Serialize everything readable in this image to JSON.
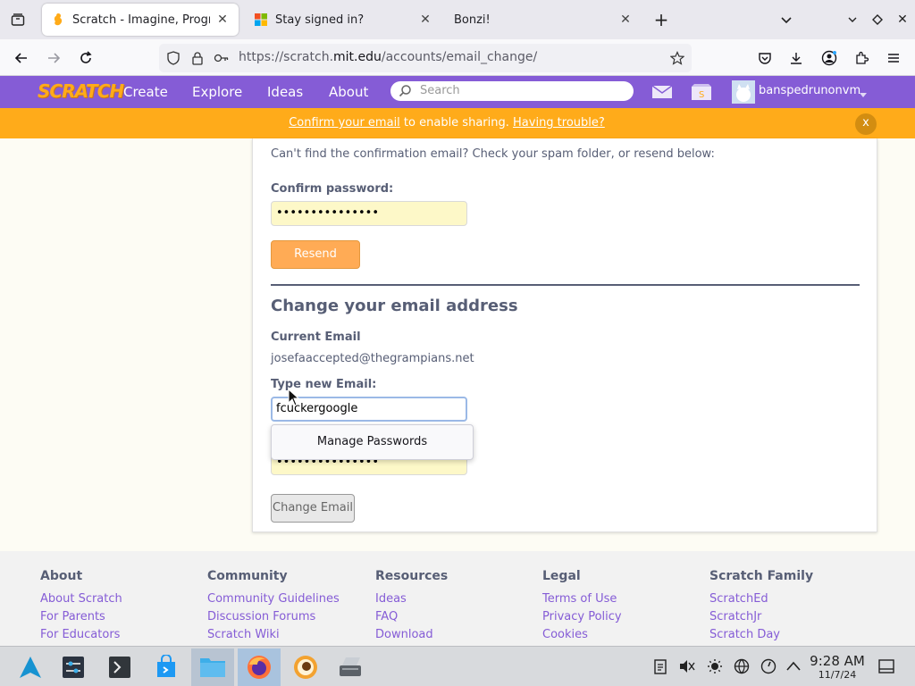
{
  "browser": {
    "tabs": [
      {
        "title": "Scratch - Imagine, Program",
        "active": true
      },
      {
        "title": "Stay signed in?",
        "active": false
      },
      {
        "title": "Bonzi!",
        "active": false
      }
    ],
    "url_prefix": "https://scratch.",
    "url_domain": "mit.edu",
    "url_path": "/accounts/email_change/"
  },
  "scratch_nav": {
    "logo": "SCRATCH",
    "items": [
      "Create",
      "Explore",
      "Ideas",
      "About"
    ],
    "search_placeholder": "Search",
    "username": "banspedrunonvm"
  },
  "banner": {
    "confirm_link": "Confirm your email",
    "middle": " to enable sharing. ",
    "trouble_link": "Having trouble?",
    "close": "x"
  },
  "form": {
    "info": "Can't find the confirmation email? Check your spam folder, or resend below:",
    "confirm_password_label": "Confirm password:",
    "confirm_password_value": "•••••••••••••••",
    "resend_label": "Resend",
    "change_title": "Change your email address",
    "current_email_label": "Current Email",
    "current_email_value": "josefaaccepted@thegrampians.net",
    "new_email_label": "Type new Email:",
    "new_email_value": "fcuckergoogle",
    "password_value": "•••••••••••••••",
    "change_button": "Change Email",
    "autofill_popup": "Manage Passwords"
  },
  "footer": {
    "columns": [
      {
        "heading": "About",
        "links": [
          "About Scratch",
          "For Parents",
          "For Educators"
        ]
      },
      {
        "heading": "Community",
        "links": [
          "Community Guidelines",
          "Discussion Forums",
          "Scratch Wiki"
        ]
      },
      {
        "heading": "Resources",
        "links": [
          "Ideas",
          "FAQ",
          "Download"
        ]
      },
      {
        "heading": "Legal",
        "links": [
          "Terms of Use",
          "Privacy Policy",
          "Cookies"
        ]
      },
      {
        "heading": "Scratch Family",
        "links": [
          "ScratchEd",
          "ScratchJr",
          "Scratch Day"
        ]
      }
    ]
  },
  "taskbar": {
    "time": "9:28 AM",
    "date": "11/7/24"
  },
  "colors": {
    "scratch_purple": "#855cd6",
    "banner_orange": "#ffab1a",
    "resend_orange": "#ffab55"
  }
}
